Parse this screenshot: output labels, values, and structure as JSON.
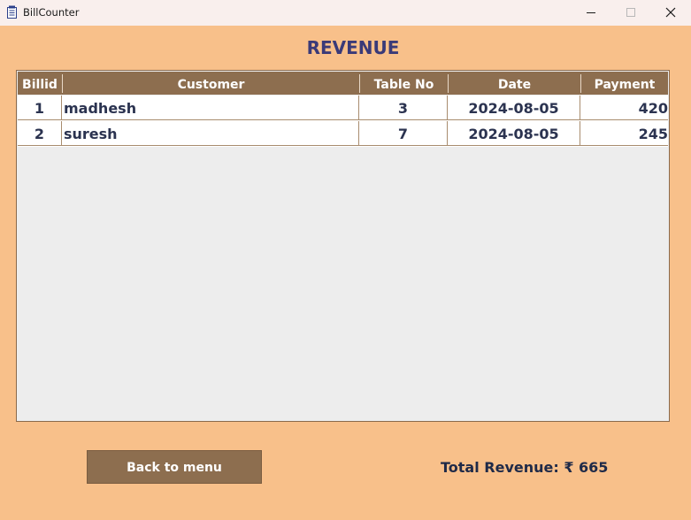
{
  "window": {
    "title": "BillCounter",
    "controls": {
      "minimize": "minimize-icon",
      "maximize": "maximize-icon",
      "close": "close-icon"
    }
  },
  "page": {
    "heading": "REVENUE"
  },
  "table": {
    "columns": [
      "Billid",
      "Customer",
      "Table No",
      "Date",
      "Payment"
    ],
    "rows": [
      {
        "billid": "1",
        "customer": "madhesh",
        "table_no": "3",
        "date": "2024-08-05",
        "payment": "420"
      },
      {
        "billid": "2",
        "customer": "suresh",
        "table_no": "7",
        "date": "2024-08-05",
        "payment": "245"
      }
    ]
  },
  "footer": {
    "back_label": "Back to menu",
    "total_label": "Total Revenue: ₹ 665"
  },
  "colors": {
    "background": "#f8c08a",
    "header": "#8d6e4f",
    "heading_text": "#3a3a78",
    "table_body": "#ededed"
  }
}
